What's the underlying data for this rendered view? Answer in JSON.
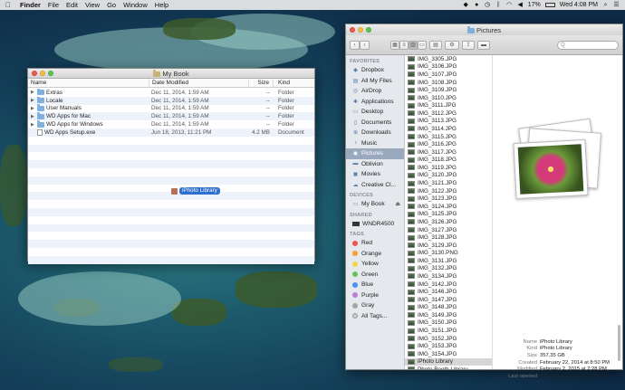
{
  "menubar": {
    "app": "Finder",
    "items": [
      "File",
      "Edit",
      "View",
      "Go",
      "Window",
      "Help"
    ],
    "battery": "17%",
    "clock": "Wed 4:08 PM"
  },
  "mybook": {
    "title": "My Book",
    "columns": {
      "name": "Name",
      "date": "Date Modified",
      "size": "Size",
      "kind": "Kind"
    },
    "rows": [
      {
        "name": "Extras",
        "date": "Dec 11, 2014, 1:59 AM",
        "size": "--",
        "kind": "Folder"
      },
      {
        "name": "Locale",
        "date": "Dec 11, 2014, 1:59 AM",
        "size": "--",
        "kind": "Folder"
      },
      {
        "name": "User Manuals",
        "date": "Dec 11, 2014, 1:59 AM",
        "size": "--",
        "kind": "Folder"
      },
      {
        "name": "WD Apps for Mac",
        "date": "Dec 11, 2014, 1:59 AM",
        "size": "--",
        "kind": "Folder"
      },
      {
        "name": "WD Apps for Windows",
        "date": "Dec 11, 2014, 1:59 AM",
        "size": "--",
        "kind": "Folder"
      },
      {
        "name": "WD Apps Setup.exe",
        "date": "Jun 18, 2013, 11:21 PM",
        "size": "4.2 MB",
        "kind": "Document"
      }
    ],
    "drag_label": "iPhoto Library"
  },
  "pictures": {
    "title": "Pictures",
    "search_placeholder": "Q",
    "sidebar": {
      "favorites_header": "FAVORITES",
      "favorites": [
        "Dropbox",
        "All My Files",
        "AirDrop",
        "Applications",
        "Desktop",
        "Documents",
        "Downloads",
        "Music",
        "Pictures",
        "Oblivion",
        "Movies",
        "Creative Cl..."
      ],
      "devices_header": "DEVICES",
      "device": "My Book",
      "shared_header": "SHARED",
      "shared": "WNDR4500",
      "tags_header": "TAGS",
      "tags": [
        {
          "name": "Red",
          "color": "#f0544c"
        },
        {
          "name": "Orange",
          "color": "#f5a03a"
        },
        {
          "name": "Yellow",
          "color": "#f3d54a"
        },
        {
          "name": "Green",
          "color": "#66c558"
        },
        {
          "name": "Blue",
          "color": "#4d8ff0"
        },
        {
          "name": "Purple",
          "color": "#c07ad8"
        },
        {
          "name": "Gray",
          "color": "#a5a5a5"
        }
      ],
      "all_tags": "All Tags..."
    },
    "files": [
      "IMG_3305.JPG",
      "IMG_3106.JPG",
      "IMG_3107.JPG",
      "IMG_3108.JPG",
      "IMG_3109.JPG",
      "IMG_3110.JPG",
      "IMG_3111.JPG",
      "IMG_3112.JPG",
      "IMG_3113.JPG",
      "IMG_3114.JPG",
      "IMG_3115.JPG",
      "IMG_3116.JPG",
      "IMG_3117.JPG",
      "IMG_3118.JPG",
      "IMG_3119.JPG",
      "IMG_3120.JPG",
      "IMG_3121.JPG",
      "IMG_3122.JPG",
      "IMG_3123.JPG",
      "IMG_3124.JPG",
      "IMG_3125.JPG",
      "IMG_3126.JPG",
      "IMG_3127.JPG",
      "IMG_3128.JPG",
      "IMG_3129.JPG",
      "IMG_3130.PNG",
      "IMG_3131.JPG",
      "IMG_3132.JPG",
      "IMG_3134.JPG",
      "IMG_3142.JPG",
      "IMG_3146.JPG",
      "IMG_3147.JPG",
      "IMG_3148.JPG",
      "IMG_3149.JPG",
      "IMG_3150.JPG",
      "IMG_3151.JPG",
      "IMG_3152.JPG",
      "IMG_3153.JPG",
      "IMG_3154.JPG",
      "iPhoto Library",
      "Photo Booth Library"
    ],
    "info": [
      {
        "k": "Name",
        "v": "iPhoto Library"
      },
      {
        "k": "Kind",
        "v": "iPhoto Library"
      },
      {
        "k": "Size",
        "v": "357.35 GB"
      },
      {
        "k": "Created",
        "v": "February 22, 2014 at 8:50 PM"
      },
      {
        "k": "Modified",
        "v": "February 2, 2015 at 2:28 PM"
      },
      {
        "k": "Last opened",
        "v": "February 2, 2015 at 2:28 PM"
      }
    ]
  }
}
